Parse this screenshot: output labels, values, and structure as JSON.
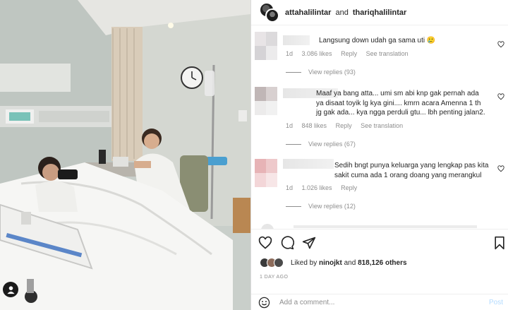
{
  "header": {
    "user1": "attahalilintar",
    "conjunction": "and",
    "user2": "thariqhalilintar"
  },
  "comments": [
    {
      "text": "Langsung down udah ga sama uti 🥲",
      "meta": {
        "time": "1d",
        "likes": "3.086 likes",
        "reply": "Reply",
        "translate": "See translation"
      },
      "view_replies": "View replies (93)"
    },
    {
      "text": "Maaf ya bang atta... umi sm abi knp gak pernah ada ya disaat toyik lg kya gini.... kmrn acara Amenna 1 th jg gak ada... kya ngga perduli gtu... lbh penting jalan2.",
      "meta": {
        "time": "1d",
        "likes": "848 likes",
        "reply": "Reply",
        "translate": "See translation"
      },
      "view_replies": "View replies (67)"
    },
    {
      "text": "Sedih bngt punya keluarga yang lengkap pas kita sakit cuma ada 1 orang doang yang merangkul",
      "meta": {
        "time": "1d",
        "likes": "1.026 likes",
        "reply": "Reply"
      },
      "view_replies": "View replies (12)"
    }
  ],
  "likes": {
    "prefix": "Liked by",
    "user": "ninojkt",
    "suffix": "and",
    "count": "818,126 others"
  },
  "timestamp": "1 DAY AGO",
  "add_comment": {
    "placeholder": "Add a comment...",
    "post_label": "Post"
  },
  "icons": {
    "like": "heart-icon",
    "comment": "comment-icon",
    "share": "send-icon",
    "save": "bookmark-icon",
    "emoji": "smiley-icon",
    "tag": "user-tag-icon"
  },
  "colors": {
    "post_button": "#b3dbff",
    "secondary_text": "#8e8e8e",
    "primary_text": "#262626"
  }
}
